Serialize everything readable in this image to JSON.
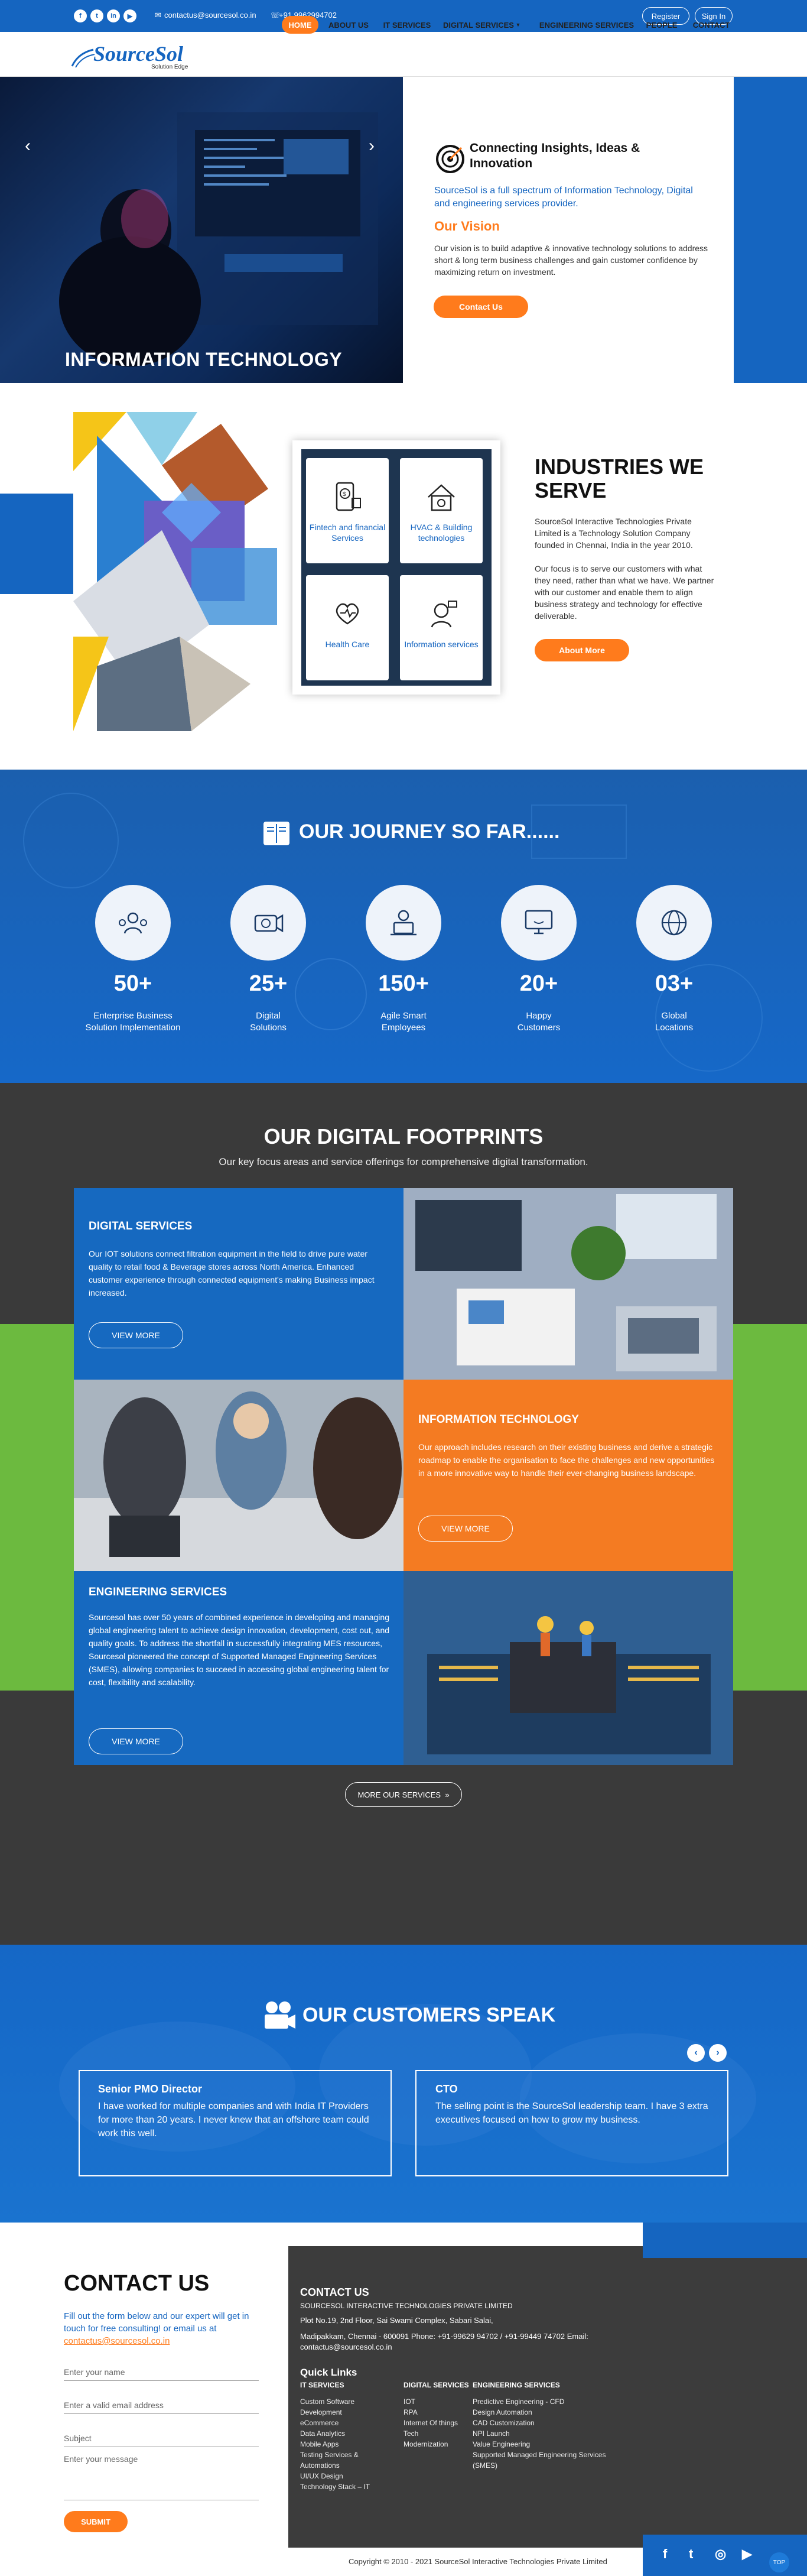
{
  "topbar": {
    "social": [
      "f",
      "t",
      "in",
      "▶"
    ],
    "email": "contactus@sourcesol.co.in",
    "phone": "+91 9962994702",
    "register": "Register",
    "signin": "Sign In"
  },
  "nav": {
    "logo": "SourceSol",
    "tagline": "Solution Edge",
    "items": [
      "HOME",
      "ABOUT US",
      "IT SERVICES",
      "DIGITAL SERVICES",
      "ENGINEERING SERVICES",
      "PEOPLE",
      "CONTACT"
    ]
  },
  "hero": {
    "title": "INFORMATION TECHNOLOGY",
    "heading": "Connecting Insights, Ideas & Innovation",
    "lead": "SourceSol is a full spectrum of Information Technology, Digital and engineering services provider.",
    "vision_head": "Our Vision",
    "vision_text": "Our vision is to build adaptive & innovative technology solutions to address short & long term business challenges and gain customer confidence by maximizing return on investment.",
    "button": "Contact Us"
  },
  "industries": {
    "title_line1": "INDUSTRIES WE",
    "title_line2": "SERVE",
    "p1": "SourceSol Interactive Technologies Private Limited is a Technology Solution Company founded in Chennai, India in the year 2010.",
    "p2": "Our focus is to serve our customers with what they need, rather than what we have. We partner with our customer and enable them to align business strategy and technology for effective deliverable.",
    "button": "About More",
    "cards": [
      "Fintech and financial Services",
      "HVAC & Building technologies",
      "Health Care",
      "Information services"
    ]
  },
  "journey": {
    "title": "OUR JOURNEY SO FAR......",
    "stats": [
      {
        "num": "50+",
        "label1": "Enterprise Business",
        "label2": "Solution Implementation"
      },
      {
        "num": "25+",
        "label1": "Digital",
        "label2": "Solutions"
      },
      {
        "num": "150+",
        "label1": "Agile Smart",
        "label2": "Employees"
      },
      {
        "num": "20+",
        "label1": "Happy",
        "label2": "Customers"
      },
      {
        "num": "03+",
        "label1": "Global",
        "label2": "Locations"
      }
    ]
  },
  "footprints": {
    "title": "OUR DIGITAL FOOTPRINTS",
    "subtitle": "Our key focus areas and service offerings for comprehensive digital transformation.",
    "digital_head": "DIGITAL SERVICES",
    "digital_body": "Our IOT solutions connect filtration equipment in the field to drive pure water quality to retail food & Beverage stores across North America. Enhanced customer experience through connected equipment's making Business impact increased.",
    "it_head": "INFORMATION TECHNOLOGY",
    "it_body": "Our approach includes research on their existing business and derive a strategic roadmap to enable the organisation to face the challenges and new opportunities in a more innovative way to handle their ever-changing business landscape.",
    "eng_head": "ENGINEERING SERVICES",
    "eng_body": "Sourcesol has over 50 years of combined experience in developing and managing global engineering talent to achieve design innovation, development, cost out, and quality goals. To address the shortfall in successfully integrating MES resources, Sourcesol pioneered the concept of Supported Managed Engineering Services (SMES), allowing companies to succeed in accessing global engineering talent for cost, flexibility and scalability.",
    "view_more": "VIEW MORE",
    "more_services": "MORE OUR SERVICES"
  },
  "customers": {
    "title": "OUR CUSTOMERS SPEAK",
    "t1_head": "Senior PMO Director",
    "t1_body": "I have worked for multiple companies and with India IT Providers for more than 20 years. I never knew that an offshore team could work this well.",
    "t2_head": "CTO",
    "t2_body": "The selling point is the SourceSol leadership team. I have 3 extra executives focused on how to grow my business."
  },
  "contact": {
    "title": "CONTACT US",
    "intro": "Fill out the form below and our expert will get in touch for free consulting! or email us at",
    "intro_email": "contactus@sourcesol.co.in",
    "name_ph": "Enter your name",
    "email_ph": "Enter a valid email address",
    "subject_ph": "Subject",
    "message_ph": "Enter your message",
    "submit": "SUBMIT"
  },
  "footer": {
    "contact_head": "CONTACT US",
    "company": "SOURCESOL INTERACTIVE TECHNOLOGIES PRIVATE LIMITED",
    "addr1": "Plot No.19, 2nd Floor, Sai Swami Complex, Sabari Salai,",
    "addr2": "Madipakkam, Chennai - 600091 Phone: +91-99629 94702 / +91-99449 74702 Email:",
    "addr3": "contactus@sourcesol.co.in",
    "quick_links": "Quick Links",
    "col1_head": "IT SERVICES",
    "col1": [
      "Custom Software Development",
      "eCommerce",
      "Data Analytics",
      "Mobile Apps",
      "Testing Services & Automations",
      "UI/UX Design",
      "Technology Stack – IT"
    ],
    "col2_head": "DIGITAL SERVICES",
    "col2": [
      "IOT",
      "RPA",
      "Internet Of things",
      "Tech Modernization"
    ],
    "col3_head": "ENGINEERING SERVICES",
    "col3": [
      "Predictive Engineering - CFD",
      "Design Automation",
      "CAD Customization",
      "NPI Launch",
      "Value Engineering",
      "Supported Managed Engineering Services (SMES)"
    ],
    "copyright": "Copyright © 2010 - 2021 SourceSol Interactive Technologies Private Limited",
    "icons": [
      "f",
      "t",
      "◎",
      "▶"
    ],
    "top": "TOP"
  }
}
